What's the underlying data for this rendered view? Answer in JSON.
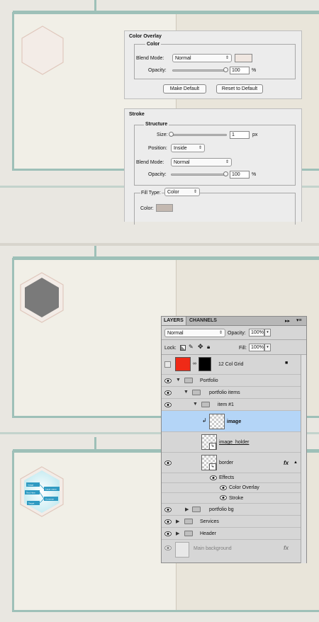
{
  "color_overlay": {
    "title": "Color Overlay",
    "group": "Color",
    "blend_label": "Blend Mode:",
    "blend_value": "Normal",
    "opacity_label": "Opacity:",
    "opacity_value": "100",
    "percent": "%",
    "make_default": "Make Default",
    "reset_default": "Reset to Default",
    "swatch_color": "#efe6e0"
  },
  "stroke": {
    "title": "Stroke",
    "group": "Structure",
    "size_label": "Size:",
    "size_value": "1",
    "size_unit": "px",
    "position_label": "Position:",
    "position_value": "Inside",
    "blend_label": "Blend Mode:",
    "blend_value": "Normal",
    "opacity_label": "Opacity:",
    "opacity_value": "100",
    "percent": "%",
    "filltype_label": "Fill Type:",
    "filltype_value": "Color",
    "color_label": "Color:",
    "swatch_color": "#c3b8b0"
  },
  "diagram": {
    "labels": [
      "Image",
      "Layer name",
      "Text Here",
      "Common",
      "Target"
    ]
  },
  "layers": {
    "tabs": [
      "LAYERS",
      "CHANNELS"
    ],
    "blend_value": "Normal",
    "opacity_label": "Opacity:",
    "opacity_value": "100%",
    "lock_label": "Lock:",
    "fill_label": "Fill:",
    "fill_value": "100%",
    "rows": {
      "grid": "12 Col Grid",
      "portfolio": "Portfolio",
      "portfolio_items": "portfolio items",
      "item1": "item #1",
      "image": "image",
      "image_holder": "image_holder",
      "border": "border",
      "effects": "Effects",
      "color_overlay": "Color Overlay",
      "stroke": "Stroke",
      "portfolio_bg": "portfolio bg",
      "services": "Services",
      "header": "Header",
      "main_background": "Main background"
    },
    "fx": "fx"
  }
}
